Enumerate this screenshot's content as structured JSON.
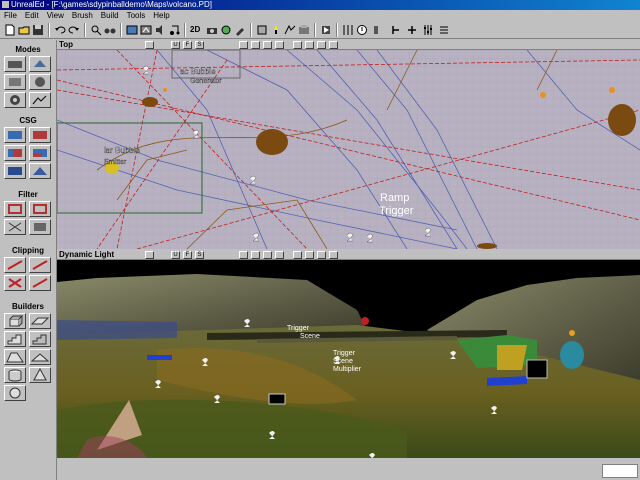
{
  "window": {
    "title": "UnrealEd - [F:\\games\\sdypinballdemo\\Maps\\volcano.PD]"
  },
  "menu": [
    "File",
    "Edit",
    "View",
    "Brush",
    "Build",
    "Tools",
    "Help"
  ],
  "toolbar": {
    "label_2d": "2D"
  },
  "left_panel": {
    "groups": [
      {
        "label": "Modes"
      },
      {
        "label": "CSG"
      },
      {
        "label": "Filter"
      },
      {
        "label": "Clipping"
      },
      {
        "label": "Builders"
      }
    ]
  },
  "viewport_top": {
    "name": "Top",
    "btn_a": "U",
    "btn_b": "F",
    "btn_c": "S",
    "labels": {
      "bubble1": "ac Bubble",
      "bubble1b": "Generator",
      "bubble2": "lar Bubble",
      "bubble2b": "Emitter",
      "ramp1": "Ramp",
      "ramp2": "Trigger"
    }
  },
  "viewport_persp": {
    "name": "Dynamic Light",
    "btn_a": "U",
    "btn_b": "F",
    "btn_c": "S",
    "labels": {
      "a1": "Trigger",
      "a2": "Scene",
      "a3": "Multiplier",
      "b1": "Trigger",
      "b2": "Scene",
      "b3": "Multiplier"
    }
  },
  "colors": {
    "title_start": "#00007b",
    "title_end": "#1084d0",
    "panel": "#c0c0c0",
    "grid_bg": "#b8b1c1"
  }
}
